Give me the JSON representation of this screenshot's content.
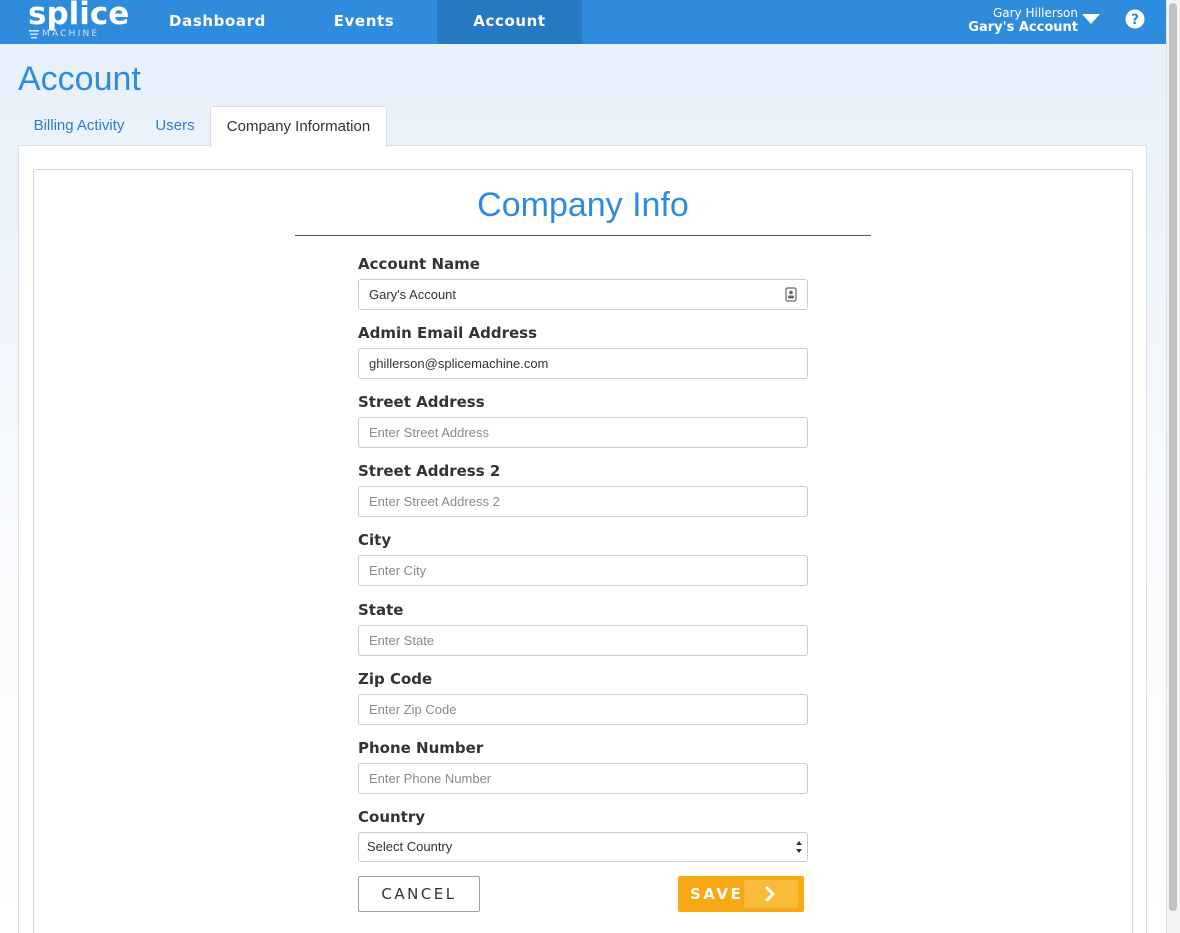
{
  "brand": {
    "logo_main": "splice",
    "logo_sub": "MACHINE",
    "primary_color": "#2f8bdc",
    "accent_color": "#f7a814"
  },
  "nav": {
    "items": [
      {
        "label": "Dashboard",
        "active": false
      },
      {
        "label": "Events",
        "active": false
      },
      {
        "label": "Account",
        "active": true
      }
    ],
    "user_name": "Gary Hillerson",
    "account_name": "Gary's Account",
    "user_menu_icon": "caret-down-icon",
    "help_icon": "help-icon"
  },
  "page": {
    "title": "Account",
    "tabs": [
      {
        "label": "Billing Activity",
        "active": false
      },
      {
        "label": "Users",
        "active": false
      },
      {
        "label": "Company Information",
        "active": true
      }
    ]
  },
  "form": {
    "title": "Company Info",
    "fields": [
      {
        "label": "Account Name",
        "value": "Gary's Account",
        "placeholder": ""
      },
      {
        "label": "Admin Email Address",
        "value": "ghillerson@splicemachine.com",
        "placeholder": ""
      },
      {
        "label": "Street Address",
        "value": "",
        "placeholder": "Enter Street Address"
      },
      {
        "label": "Street Address 2",
        "value": "",
        "placeholder": "Enter Street Address 2"
      },
      {
        "label": "City",
        "value": "",
        "placeholder": "Enter City"
      },
      {
        "label": "State",
        "value": "",
        "placeholder": "Enter State"
      },
      {
        "label": "Zip Code",
        "value": "",
        "placeholder": "Enter Zip Code"
      },
      {
        "label": "Phone Number",
        "value": "",
        "placeholder": "Enter Phone Number"
      }
    ],
    "country_label": "Country",
    "country_selected": "Select Country",
    "cancel_label": "CANCEL",
    "save_label": "SAVE"
  }
}
